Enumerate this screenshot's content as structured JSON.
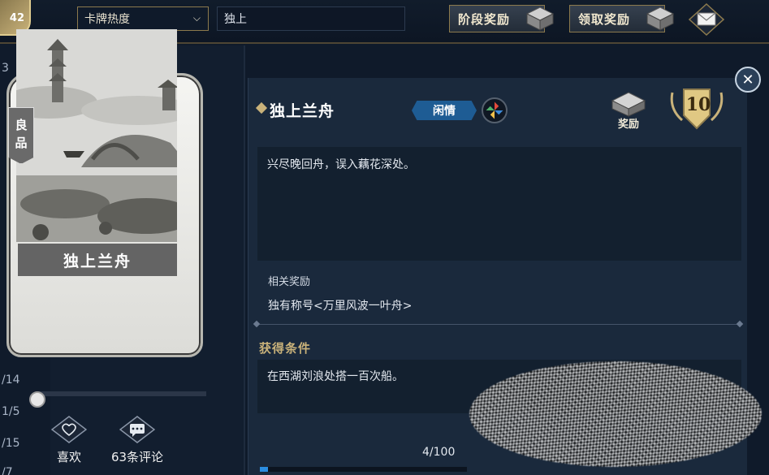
{
  "topbar": {
    "level_corner": "42",
    "sort_select": "卡牌热度",
    "search_value": "独上",
    "stage_reward_label": "阶段奖励",
    "claim_reward_label": "领取奖励"
  },
  "left_strip": {
    "numbers": [
      "3",
      "/14",
      "1/5",
      "/15",
      "/7"
    ]
  },
  "card": {
    "rarity": [
      "良",
      "品"
    ],
    "name": "独上兰舟"
  },
  "social": {
    "like_label": "喜欢",
    "comment_label": "63条评论"
  },
  "card_slider": {
    "position": 0.0
  },
  "detail": {
    "title": "独上兰舟",
    "tag": "闲情",
    "reward_label": "奖励",
    "level": "10",
    "description": "兴尽晚回舟，误入藕花深处。",
    "related_title": "相关奖励",
    "related_value": "独有称号<万里风波一叶舟>",
    "condition_title": "获得条件",
    "condition_text": "在西湖刘浪处搭一百次船。",
    "progress_text": "4/100",
    "progress_value": 4,
    "progress_max": 100
  },
  "colors": {
    "accent_gold": "#c9b27a",
    "tag_blue": "#1e5c94",
    "progress_blue": "#2b8de0"
  }
}
